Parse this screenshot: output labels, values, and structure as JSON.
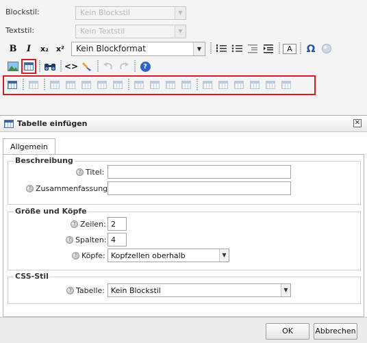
{
  "editor": {
    "block_style_label": "Blockstil:",
    "block_style_value": "Kein Blockstil",
    "text_style_label": "Textstil:",
    "text_style_value": "Kein Textstil",
    "toolbar": {
      "bold": "B",
      "italic": "I",
      "subscript": "x₂",
      "superscript": "x²",
      "block_format": "Kein Blockformat",
      "text_color": "A",
      "special_char": "Ω",
      "source": "<>",
      "help": "?"
    },
    "colors": {
      "highlight_red": "#d21e1e",
      "toolbar_bg": "#f4f4f4"
    }
  },
  "dialog": {
    "title": "Tabelle einfügen",
    "close": "✕",
    "tabs": [
      "Allgemein"
    ],
    "description": {
      "legend": "Beschreibung",
      "title_label": "Titel:",
      "title_value": "",
      "summary_label": "Zusammenfassung:",
      "summary_value": ""
    },
    "size": {
      "legend": "Größe und Köpfe",
      "rows_label": "Zeilen:",
      "rows_value": "2",
      "cols_label": "Spalten:",
      "cols_value": "4",
      "headers_label": "Köpfe:",
      "headers_value": "Kopfzellen oberhalb"
    },
    "css": {
      "legend": "CSS-Stil",
      "table_label": "Tabelle:",
      "table_value": "Kein Blockstil"
    },
    "ok": "OK",
    "cancel": "Abbrechen"
  }
}
